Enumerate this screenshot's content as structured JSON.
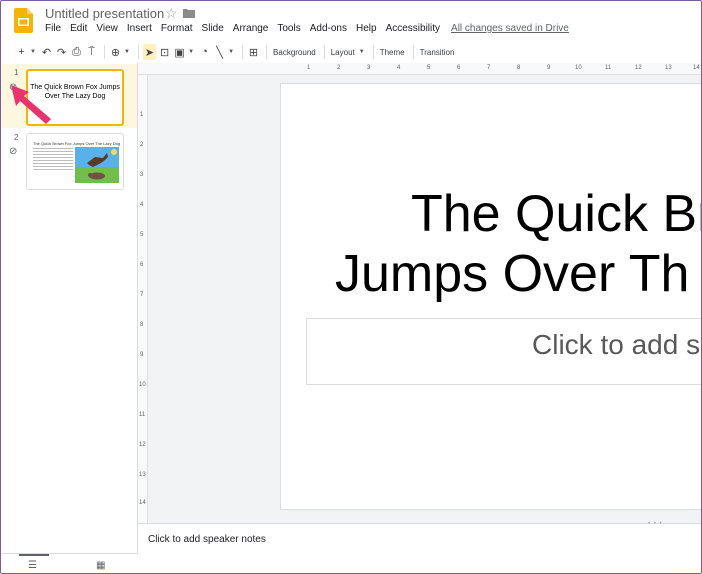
{
  "header": {
    "title": "Untitled presentation",
    "star_icon": "star-outline-icon",
    "folder_icon": "folder-icon",
    "menu": [
      "File",
      "Edit",
      "View",
      "Insert",
      "Format",
      "Slide",
      "Arrange",
      "Tools",
      "Add-ons",
      "Help",
      "Accessibility"
    ],
    "save_status": "All changes saved in Drive"
  },
  "toolbar": {
    "icons": [
      "new-slide-icon",
      "undo-icon",
      "redo-icon",
      "print-icon",
      "paint-format-icon",
      "zoom-icon",
      "select-icon",
      "text-box-icon",
      "image-icon",
      "shape-icon",
      "line-icon",
      "comment-icon"
    ],
    "background_label": "Background",
    "layout_label": "Layout",
    "theme_label": "Theme",
    "transition_label": "Transition"
  },
  "filmstrip": {
    "slides": [
      {
        "number": "1",
        "text": "The Quick Brown Fox Jumps Over The Lazy Dog",
        "selected": true
      },
      {
        "number": "2",
        "text": "The Quick Brown Fox Jumps Over The Lazy Dog",
        "selected": false
      }
    ]
  },
  "rulers": {
    "top": [
      "1",
      "2",
      "3",
      "4",
      "5",
      "6",
      "7",
      "8",
      "9",
      "10",
      "11",
      "12",
      "13",
      "14"
    ],
    "left": [
      "1",
      "2",
      "3",
      "4",
      "5",
      "6",
      "7",
      "8",
      "9",
      "10",
      "11",
      "12",
      "13",
      "14"
    ]
  },
  "slide": {
    "title_line1": "The Quick Br",
    "title_line2": "Jumps Over Th",
    "subtitle_placeholder": "Click to add s"
  },
  "notes": {
    "placeholder": "Click to add speaker notes"
  },
  "colors": {
    "accent_yellow": "#f4b400",
    "selected_slide_bg": "#fef7e0",
    "arrow_pink": "#e8336f",
    "frame_border": "#7a5aa0"
  }
}
